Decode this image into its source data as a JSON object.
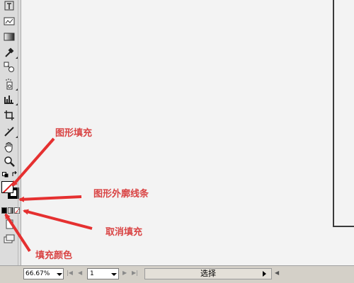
{
  "annotations": {
    "fill": "图形填充",
    "stroke": "图形外廓线条",
    "no_fill": "取消填充",
    "fill_color": "填充颜色"
  },
  "annotation_color": "#d94444",
  "statusbar": {
    "zoom": "66.67%",
    "page": "1",
    "current_tool": "选择"
  },
  "tools": [
    "type-on-path-icon",
    "graph-icon",
    "gradient-icon",
    "eyedropper-icon",
    "blend-icon",
    "symbol-sprayer-icon",
    "column-graph-icon",
    "crop-icon",
    "knife-icon",
    "hand-icon",
    "zoom-icon"
  ]
}
